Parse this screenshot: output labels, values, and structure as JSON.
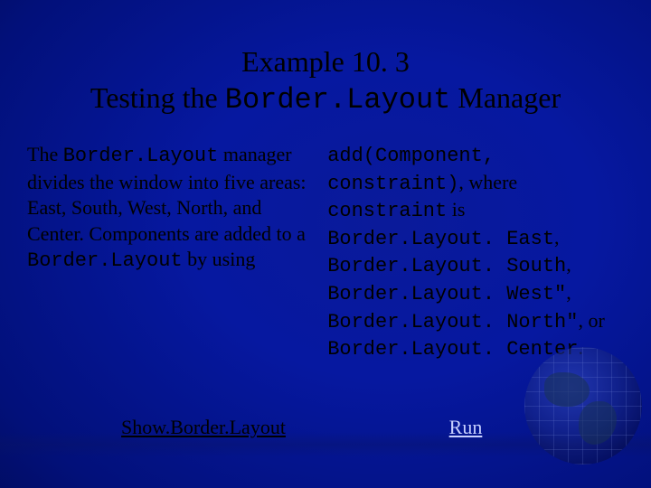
{
  "title": {
    "line1": "Example 10. 3",
    "line2_pre": "Testing the ",
    "line2_mono": "Border.Layout",
    "line2_post": " Manager"
  },
  "left": {
    "t1": "The ",
    "mono1": "Border.Layout",
    "t2": " manager divides the window into five areas: East, South, West, North, and Center. Components are added to a ",
    "mono2": "Border.Layout",
    "t3": " by using"
  },
  "right": {
    "m1": "add(Component, constraint)",
    "t1": ", where ",
    "m2": "constraint",
    "t2": " is ",
    "m3": "Border.Layout. East",
    "c1": ", ",
    "m4": "Border.Layout. South",
    "c2": ", ",
    "m5": "Border.Layout. West\"",
    "c3": ", ",
    "m6": "Border.Layout. North\"",
    "c4": ", or ",
    "m7": "Border.Layout. Center",
    "c5": "."
  },
  "buttons": {
    "show": "Show.Border.Layout",
    "run": "Run"
  }
}
